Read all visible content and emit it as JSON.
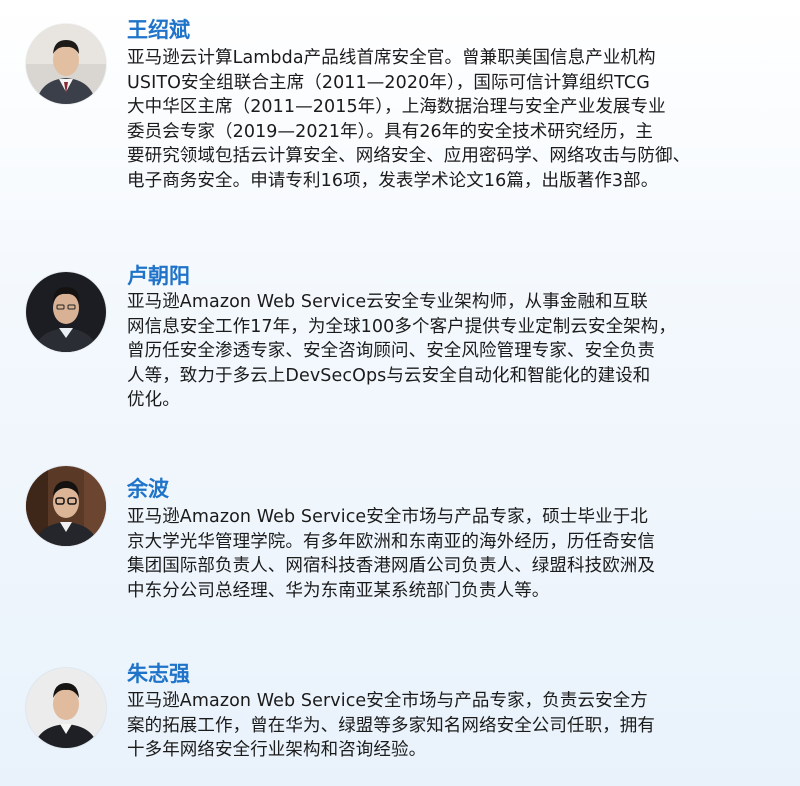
{
  "profiles": [
    {
      "name": "王绍斌",
      "bio_lines": [
        "亚马逊云计算Lambda产品线首席安全官。曾兼职美国信息产业机构",
        "USITO安全组联合主席（2011—2020年），国际可信计算组织TCG",
        "大中华区主席（2011—2015年），上海数据治理与安全产业发展专业",
        "委员会专家（2019—2021年）。具有26年的安全技术研究经历，主",
        "要研究领域包括云计算安全、网络安全、应用密码学、网络攻击与防御、",
        "电子商务安全。申请专利16项，发表学术论文16篇，出版著作3部。"
      ]
    },
    {
      "name": "卢朝阳",
      "bio_lines": [
        "亚马逊Amazon Web Service云安全专业架构师，从事金融和互联",
        "网信息安全工作17年，为全球100多个客户提供专业定制云安全架构，",
        "曾历任安全渗透专家、安全咨询顾问、安全风险管理专家、安全负责",
        "人等，致力于多云上DevSecOps与云安全自动化和智能化的建设和",
        "优化。"
      ]
    },
    {
      "name": "余波",
      "bio_lines": [
        "亚马逊Amazon Web Service安全市场与产品专家，硕士毕业于北",
        "京大学光华管理学院。有多年欧洲和东南亚的海外经历，历任奇安信",
        "集团国际部负责人、网宿科技香港网盾公司负责人、绿盟科技欧洲及",
        "中东分公司总经理、华为东南亚某系统部门负责人等。"
      ]
    },
    {
      "name": "朱志强",
      "bio_lines": [
        "亚马逊Amazon Web Service安全市场与产品专家，负责云安全方",
        "案的拓展工作，曾在华为、绿盟等多家知名网络安全公司任职，拥有",
        "十多年网络安全行业架构和咨询经验。"
      ]
    }
  ]
}
